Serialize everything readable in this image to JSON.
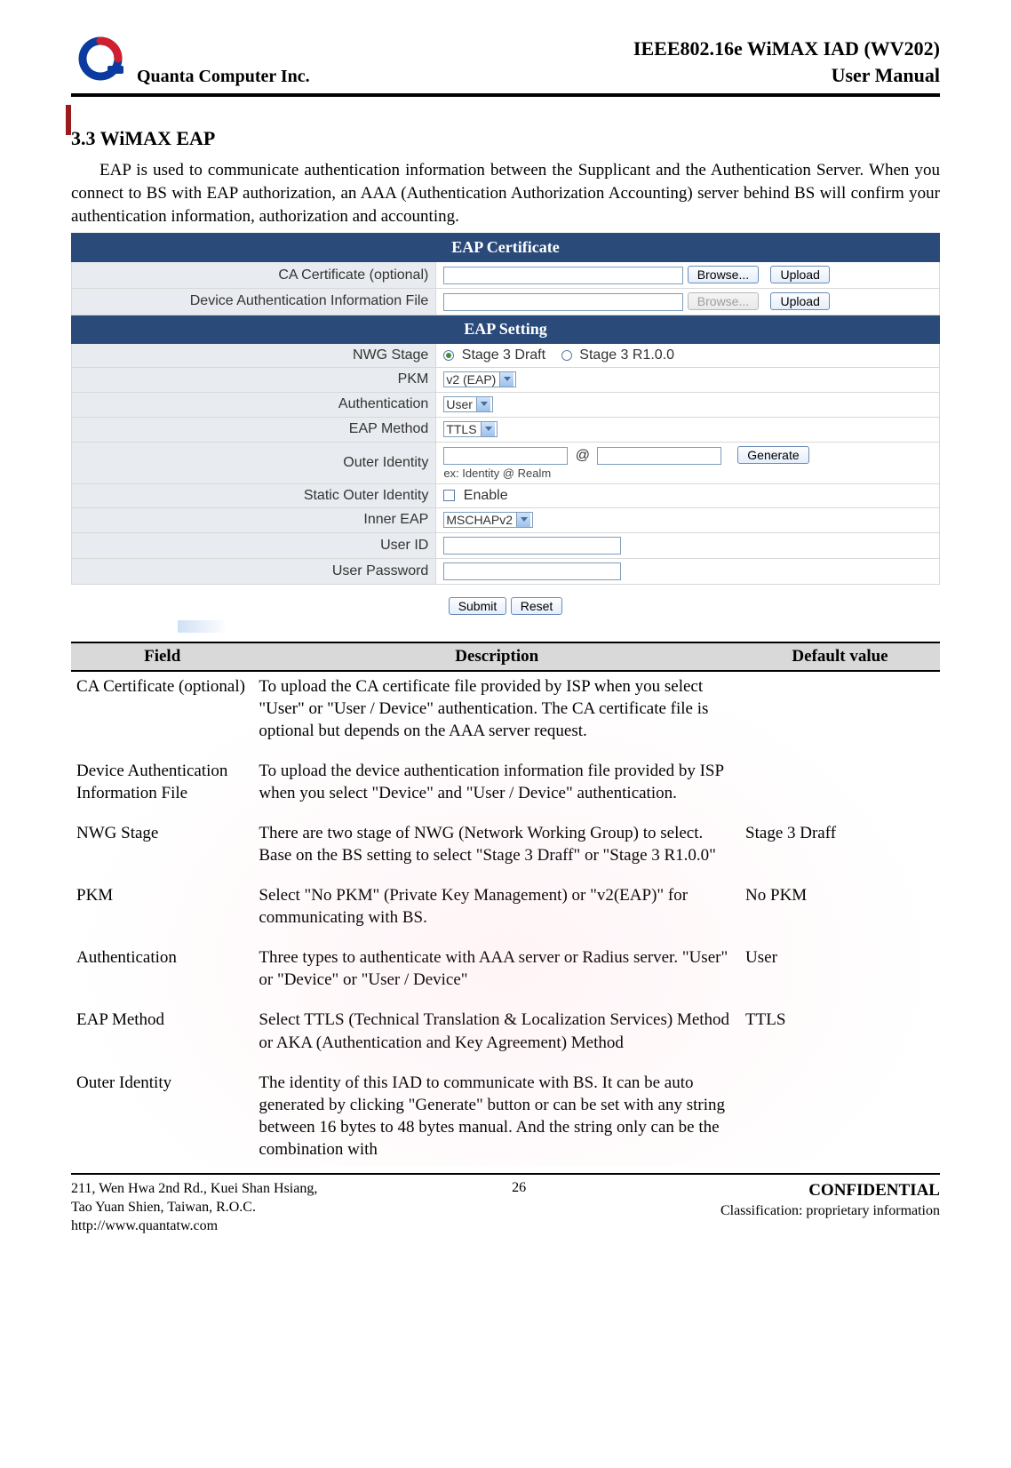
{
  "header": {
    "company": "Quanta  Computer  Inc.",
    "title_right_1": "IEEE802.16e  WiMAX  IAD  (WV202)",
    "title_right_2": "User  Manual"
  },
  "section": {
    "number_title": "3.3  WiMAX EAP",
    "intro": "EAP is used to communicate authentication information between the Supplicant and the Authentication Server. When you connect to BS with EAP authorization, an AAA (Authentication Authorization Accounting) server behind BS will confirm your authentication information, authorization and accounting."
  },
  "eap_cert": {
    "header": "EAP Certificate",
    "rows": [
      {
        "label": "CA Certificate (optional)",
        "browse": "Browse...",
        "upload": "Upload",
        "browse_disabled": false
      },
      {
        "label": "Device Authentication Information File",
        "browse": "Browse...",
        "upload": "Upload",
        "browse_disabled": true
      }
    ]
  },
  "eap_setting": {
    "header": "EAP Setting",
    "nwg_label": "NWG Stage",
    "nwg_opt1": "Stage 3 Draft",
    "nwg_opt2": "Stage 3 R1.0.0",
    "pkm_label": "PKM",
    "pkm_value": "v2 (EAP)",
    "auth_label": "Authentication",
    "auth_value": "User",
    "eapm_label": "EAP Method",
    "eapm_value": "TTLS",
    "outer_label": "Outer Identity",
    "outer_at": "@",
    "outer_gen": "Generate",
    "outer_hint": "ex: Identity @ Realm",
    "static_label": "Static Outer Identity",
    "static_value": "Enable",
    "inner_label": "Inner EAP",
    "inner_value": "MSCHAPv2",
    "uid_label": "User ID",
    "pwd_label": "User Password"
  },
  "buttons": {
    "submit": "Submit",
    "reset": "Reset"
  },
  "desc": {
    "head": {
      "field": "Field",
      "description": "Description",
      "default": "Default value"
    },
    "rows": [
      {
        "field": "CA Certificate (optional)",
        "description": "To upload the CA certificate file provided by ISP when you select \"User\" or \"User / Device\" authentication. The CA certificate file is optional but depends on the AAA server request.",
        "default": ""
      },
      {
        "field": "Device Authentication Information File",
        "description": "To upload the device authentication information file provided by ISP when you select \"Device\" and \"User / Device\" authentication.",
        "default": ""
      },
      {
        "field": "NWG Stage",
        "description": "There are two stage of NWG (Network Working Group) to select. Base on the BS setting to select \"Stage 3 Draff\" or \"Stage 3 R1.0.0\"",
        "default": "Stage 3 Draff"
      },
      {
        "field": "PKM",
        "description": "Select \"No PKM\" (Private Key Management) or \"v2(EAP)\" for communicating with BS.",
        "default": "No PKM"
      },
      {
        "field": "Authentication",
        "description": "Three types to authenticate with AAA server or Radius server. \"User\" or \"Device\" or \"User / Device\"",
        "default": "User"
      },
      {
        "field": "EAP Method",
        "description": "Select TTLS (Technical Translation & Localization Services) Method or AKA (Authentication and Key Agreement) Method",
        "default": "TTLS"
      },
      {
        "field": "Outer Identity",
        "description": "The identity of this IAD to communicate with BS. It can be auto generated by clicking \"Generate\" button or can be set with any string between 16 bytes to 48 bytes manual. And the string only can be the combination with",
        "default": ""
      }
    ]
  },
  "footer": {
    "addr1": "211, Wen Hwa 2nd Rd., Kuei Shan Hsiang,",
    "addr2": "Tao Yuan Shien, Taiwan, R.O.C.",
    "url": "http://www.quantatw.com",
    "page": "26",
    "conf": "CONFIDENTIAL",
    "class": "Classification: proprietary information"
  }
}
